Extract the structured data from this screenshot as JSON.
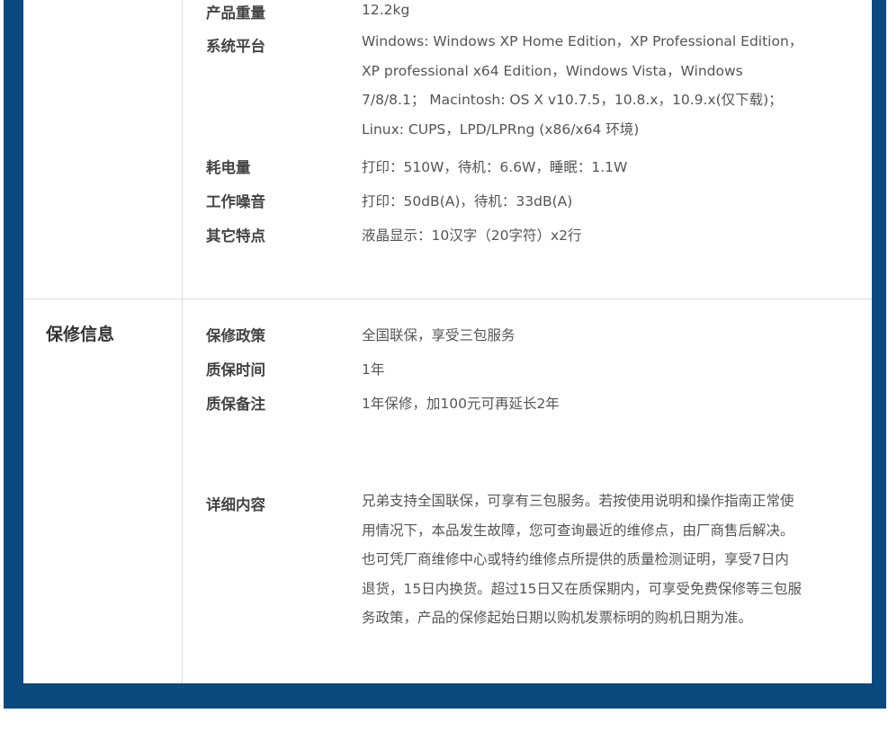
{
  "colors": {
    "frame": "#0a4a7e",
    "card": "#ffffff",
    "divider": "#dcdcdc"
  },
  "specs": {
    "weight": {
      "label": "产品重量",
      "value": "12.2kg"
    },
    "platform": {
      "label": "系统平台",
      "lines": [
        "Windows: Windows XP Home Edition，XP Professional Edition，",
        "XP professional x64 Edition，Windows Vista，Windows",
        "7/8/8.1； Macintosh: OS X v10.7.5，10.8.x，10.9.x(仅下载)；",
        "Linux: CUPS，LPD/LPRng (x86/x64 环境)"
      ]
    },
    "power": {
      "label": "耗电量",
      "value": "打印：510W，待机：6.6W，睡眠：1.1W"
    },
    "noise": {
      "label": "工作噪音",
      "value": "打印：50dB(A)，待机：33dB(A)"
    },
    "other": {
      "label": "其它特点",
      "value": "液晶显示：10汉字（20字符）x2行"
    }
  },
  "warranty": {
    "title": "保修信息",
    "policy": {
      "label": "保修政策",
      "value": "全国联保，享受三包服务"
    },
    "period": {
      "label": "质保时间",
      "value": "1年"
    },
    "remark": {
      "label": "质保备注",
      "value": "1年保修，加100元可再延长2年"
    },
    "details": {
      "label": "详细内容",
      "lines": [
        "兄弟支持全国联保，可享有三包服务。若按使用说明和操作指南正常使",
        "用情况下，本品发生故障，您可查询最近的维修点，由厂商售后解决。",
        "也可凭厂商维修中心或特约维修点所提供的质量检测证明，享受7日内",
        "退货，15日内换货。超过15日又在质保期内，可享受免费保修等三包服",
        "务政策，产品的保修起始日期以购机发票标明的购机日期为准。"
      ]
    }
  }
}
